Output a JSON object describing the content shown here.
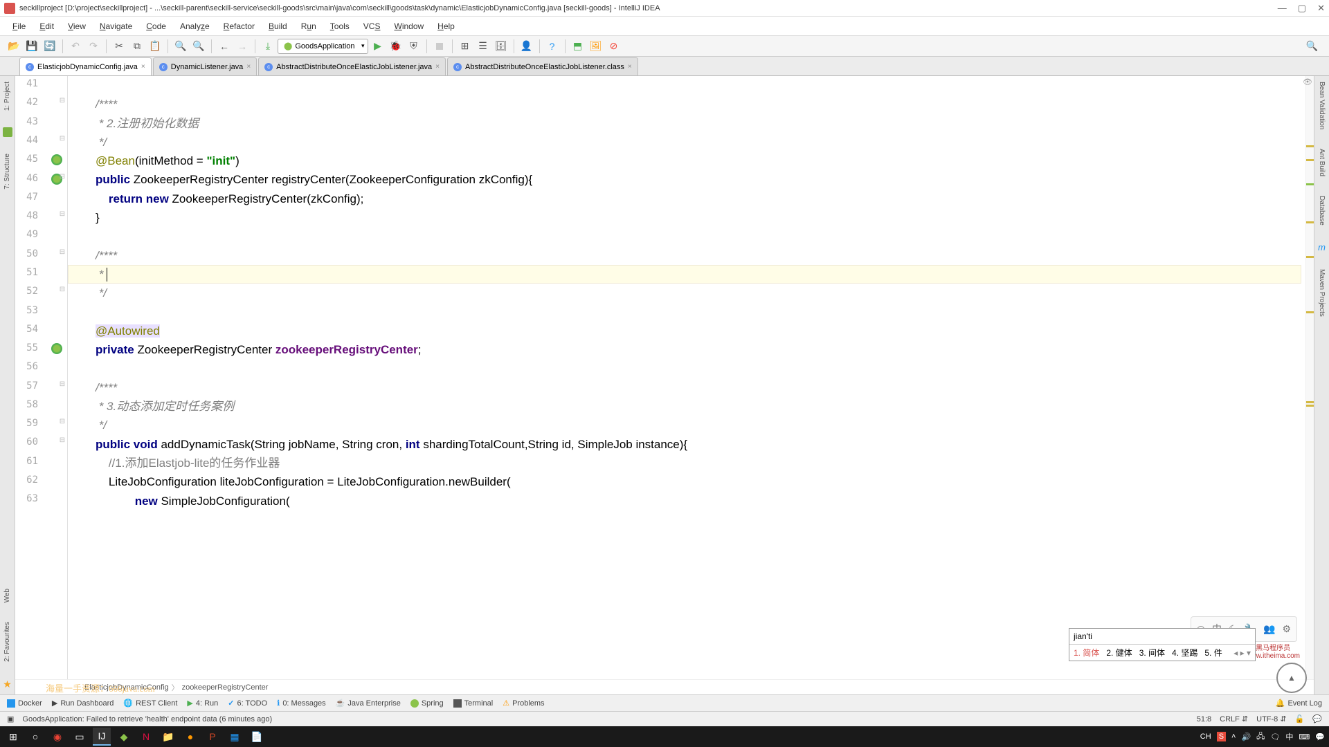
{
  "window": {
    "title": "seckillproject [D:\\project\\seckillproject] - ...\\seckill-parent\\seckill-service\\seckill-goods\\src\\main\\java\\com\\seckill\\goods\\task\\dynamic\\ElasticjobDynamicConfig.java [seckill-goods] - IntelliJ IDEA"
  },
  "menu": {
    "file": "File",
    "edit": "Edit",
    "view": "View",
    "navigate": "Navigate",
    "code": "Code",
    "analyze": "Analyze",
    "refactor": "Refactor",
    "build": "Build",
    "run": "Run",
    "tools": "Tools",
    "vcs": "VCS",
    "window": "Window",
    "help": "Help"
  },
  "runconfig": {
    "name": "GoodsApplication"
  },
  "tabs": [
    {
      "label": "ElasticjobDynamicConfig.java",
      "active": true
    },
    {
      "label": "DynamicListener.java",
      "active": false
    },
    {
      "label": "AbstractDistributeOnceElasticJobListener.java",
      "active": false
    },
    {
      "label": "AbstractDistributeOnceElasticJobListener.class",
      "active": false
    }
  ],
  "leftrail": {
    "project": "1: Project",
    "structure": "7: Structure",
    "web": "Web",
    "fav": "2: Favourites"
  },
  "rightrail": {
    "bv": "Bean Validation",
    "ant": "Ant Build",
    "db": "Database",
    "mvn": "Maven Projects",
    "m": "m"
  },
  "gutter": {
    "start": 41,
    "end": 63
  },
  "code": {
    "l42": "/****",
    "l43_pre": " * 2.",
    "l43_cn": "注册初始化数据",
    "l44": " */",
    "l45_ann": "@Bean",
    "l45_args": "(initMethod = ",
    "l45_str": "\"init\"",
    "l45_close": ")",
    "l46_pub": "public",
    "l46_ty1": " ZookeeperRegistryCenter ",
    "l46_fn": "registryCenter",
    "l46_args": "(ZookeeperConfiguration zkConfig){",
    "l47_ret": "return",
    "l47_new": " new",
    "l47_rest": " ZookeeperRegistryCenter(zkConfig);",
    "l48": "}",
    "l50": "/****",
    "l51": " * ",
    "l52": " */",
    "l54_ann": "@Autowired",
    "l55_pri": "private",
    "l55_ty": " ZookeeperRegistryCenter ",
    "l55_fld": "zookeeperRegistryCenter",
    "l55_semi": ";",
    "l57": "/****",
    "l58_pre": " * 3.",
    "l58_cn": "动态添加定时任务案例",
    "l59": " */",
    "l60_pub": "public",
    "l60_void": " void",
    "l60_fn": " addDynamicTask",
    "l60_args1": "(String jobName, String cron, ",
    "l60_int": "int",
    "l60_args2": " shardingTotalCount,String id, SimpleJob instance){",
    "l61_cmt": "//1.添加Elastjob-lite的任务作业器",
    "l62": "LiteJobConfiguration liteJobConfiguration = LiteJobConfiguration.newBuilder(",
    "l63_new": "new",
    "l63_rest": " SimpleJobConfiguration("
  },
  "breadcrumb": {
    "a": "ElasticjobDynamicConfig",
    "b": "zookeeperRegistryCenter"
  },
  "ime": {
    "input": "jian'ti",
    "c1": "1. 简体",
    "c2": "2. 健体",
    "c3": "3. 间体",
    "c4": "4. 坚踢",
    "c5": "5. 件"
  },
  "bottom": {
    "docker": "Docker",
    "rundash": "Run Dashboard",
    "rest": "REST Client",
    "run": "4: Run",
    "todo": "6: TODO",
    "messages": "0: Messages",
    "javaee": "Java Enterprise",
    "spring": "Spring",
    "terminal": "Terminal",
    "problems": "Problems",
    "eventlog": "Event Log"
  },
  "status": {
    "msg": "GoodsApplication: Failed to retrieve 'health' endpoint data (6 minutes ago)",
    "pos": "51:8",
    "le": "CRLF",
    "enc": "UTF-8",
    "branch": ""
  },
  "watermark": "海量一手资源：666java.com",
  "brand": "黑马程序员",
  "brand_url": "www.itheima.com",
  "tray": {
    "ch": "CH",
    "s": "S"
  }
}
